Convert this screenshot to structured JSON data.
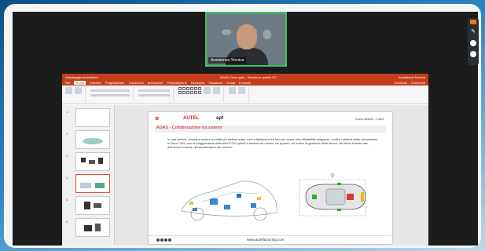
{
  "camera": {
    "participant_name": "Assistenza Tecnica"
  },
  "powerpoint": {
    "title_left": "Salvataggio automatico",
    "title_center": "ADAS-Corso.pptx - Salvato in questo PC",
    "title_right": "Assistenza Tecnica",
    "menu": [
      "File",
      "Home",
      "Inserisci",
      "Progettazione",
      "Transizioni",
      "Animazioni",
      "Presentazione",
      "Revisione",
      "Visualizza",
      "Guida",
      "Formato"
    ],
    "menu_active": "Home",
    "comment_buttons": [
      "Condividi",
      "Commenti"
    ]
  },
  "slides_panel": {
    "numbers": [
      "1",
      "2",
      "3",
      "4",
      "5",
      "6"
    ],
    "selected": "4"
  },
  "slide": {
    "logo1": "AUTEL",
    "logo2": "spf",
    "course": "Corso ADAS – CAV1",
    "title": "ADAS · Collaborazione tra sistemi",
    "body": "In una vettura, possono essere montati più sistemi adas, essi collaborano tra loro per avere una affidabilità maggiore. Inoltre i sistemi adas comunicano in linea CAN, con la maggioranza delle altre ECU quindi è sistemi veri anche sul quadro, ed inoltre la gestione delle sterzo, del freno tramite abs, dell'centro marcia, del acceleratore del motore.",
    "footer_url": "www.autelfactoring.com"
  },
  "colors": {
    "ppt_red": "#c43e1c",
    "autel_red": "#d01a1a",
    "active_speaker": "#3cc35c"
  }
}
